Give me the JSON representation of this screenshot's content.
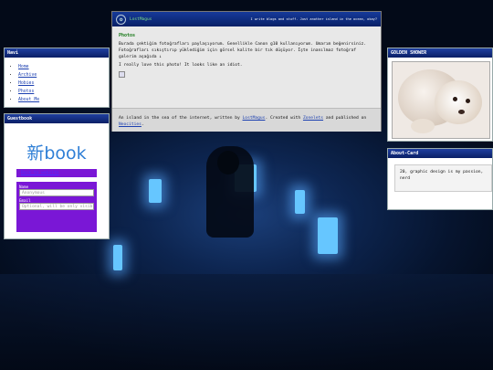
{
  "site": {
    "name": "LostMagus",
    "logo_glyph": "❂",
    "tagline": "I write blogs and stuff. Just another island in the ocean, okay?"
  },
  "post": {
    "title": "Photos",
    "body": "Burada çektiğim fotoğrafları paylaşıyorum. Genellikle Canon g10 kullanıyorum. Umarım beğenirsiniz. Fotoğrafları sıkıştırıp yüklediğim için görsel kalite bir tık düşüyor. İşte inanılmaz fotoğraf galerim aşağıda ↓",
    "note": "I really love this photo! It looks like an idiot."
  },
  "footer": {
    "pre": "An island in the sea of the internet, written by ",
    "author": "LostMagus",
    "mid1": ". Created with ",
    "tool": "Zonelets",
    "mid2": " and published on ",
    "host": "Neocities",
    "end": "."
  },
  "nav": {
    "title": "Navi",
    "items": [
      "Home",
      "Archive",
      "Hobies",
      "Photos",
      "About Me"
    ]
  },
  "guestbook": {
    "title": "Guestbook",
    "logo": "新book",
    "back_link": "Back to website",
    "name_label": "Name",
    "name_placeholder": "Anonymous",
    "email_label": "Email",
    "email_placeholder": "Optional, will be only visible to m"
  },
  "golden": {
    "title": "GOLDEN SHOWER"
  },
  "about": {
    "title": "About-Card",
    "text": "20, graphic design is my passion, nerd"
  }
}
